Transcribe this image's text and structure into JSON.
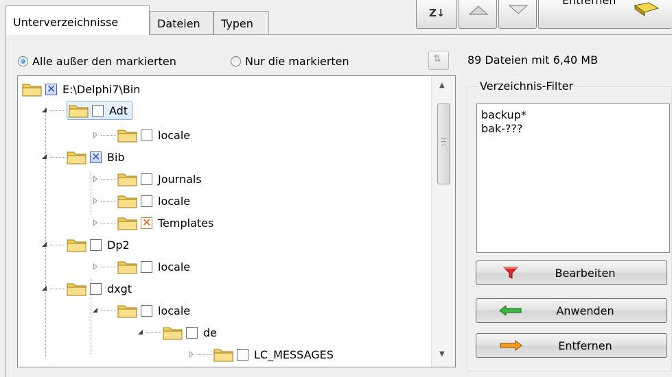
{
  "tabs": [
    {
      "label": "Unterverzeichnisse",
      "active": true
    },
    {
      "label": "Dateien",
      "active": false
    },
    {
      "label": "Typen",
      "active": false
    }
  ],
  "toolbar": {
    "sort_icon": "sort-icon",
    "up_icon": "arrow-up-icon",
    "down_icon": "arrow-down-icon",
    "remove_label": "Entfernen",
    "remove_icon": "eraser-icon"
  },
  "mode": {
    "option_all_except": "Alle außer den markierten",
    "option_only_marked": "Nur die markierten",
    "selected": "Alle außer den markierten"
  },
  "summary": "89 Dateien mit 6,40 MB",
  "tree": {
    "root": {
      "label": "E:\\Delphi7\\Bin",
      "check": "checked"
    },
    "items": [
      {
        "label": "Adt",
        "check": "unchecked",
        "expander": "open",
        "selected": true
      },
      {
        "label": "locale",
        "check": "unchecked",
        "expander": "closed"
      },
      {
        "label": "Bib",
        "check": "checked",
        "expander": "open"
      },
      {
        "label": "Journals",
        "check": "unchecked",
        "expander": "closed"
      },
      {
        "label": "locale",
        "check": "unchecked",
        "expander": "closed"
      },
      {
        "label": "Templates",
        "check": "partial",
        "expander": "closed"
      },
      {
        "label": "Dp2",
        "check": "unchecked",
        "expander": "open"
      },
      {
        "label": "locale",
        "check": "unchecked",
        "expander": "closed"
      },
      {
        "label": "dxgt",
        "check": "unchecked",
        "expander": "open"
      },
      {
        "label": "locale",
        "check": "unchecked",
        "expander": "open"
      },
      {
        "label": "de",
        "check": "unchecked",
        "expander": "open"
      },
      {
        "label": "LC_MESSAGES",
        "check": "unchecked",
        "expander": "closed"
      }
    ]
  },
  "filter": {
    "title": "Verzeichnis-Filter",
    "lines": [
      "backup*",
      "bak-???"
    ],
    "buttons": [
      {
        "label": "Bearbeiten",
        "icon": "funnel-icon"
      },
      {
        "label": "Anwenden",
        "icon": "arrow-left-icon"
      },
      {
        "label": "Entfernen",
        "icon": "arrow-right-icon"
      }
    ]
  },
  "colors": {
    "selection": "#dcebfc",
    "check_blue": "#2a50d8",
    "check_orange": "#e25a12",
    "folder": "#f5d66e"
  }
}
